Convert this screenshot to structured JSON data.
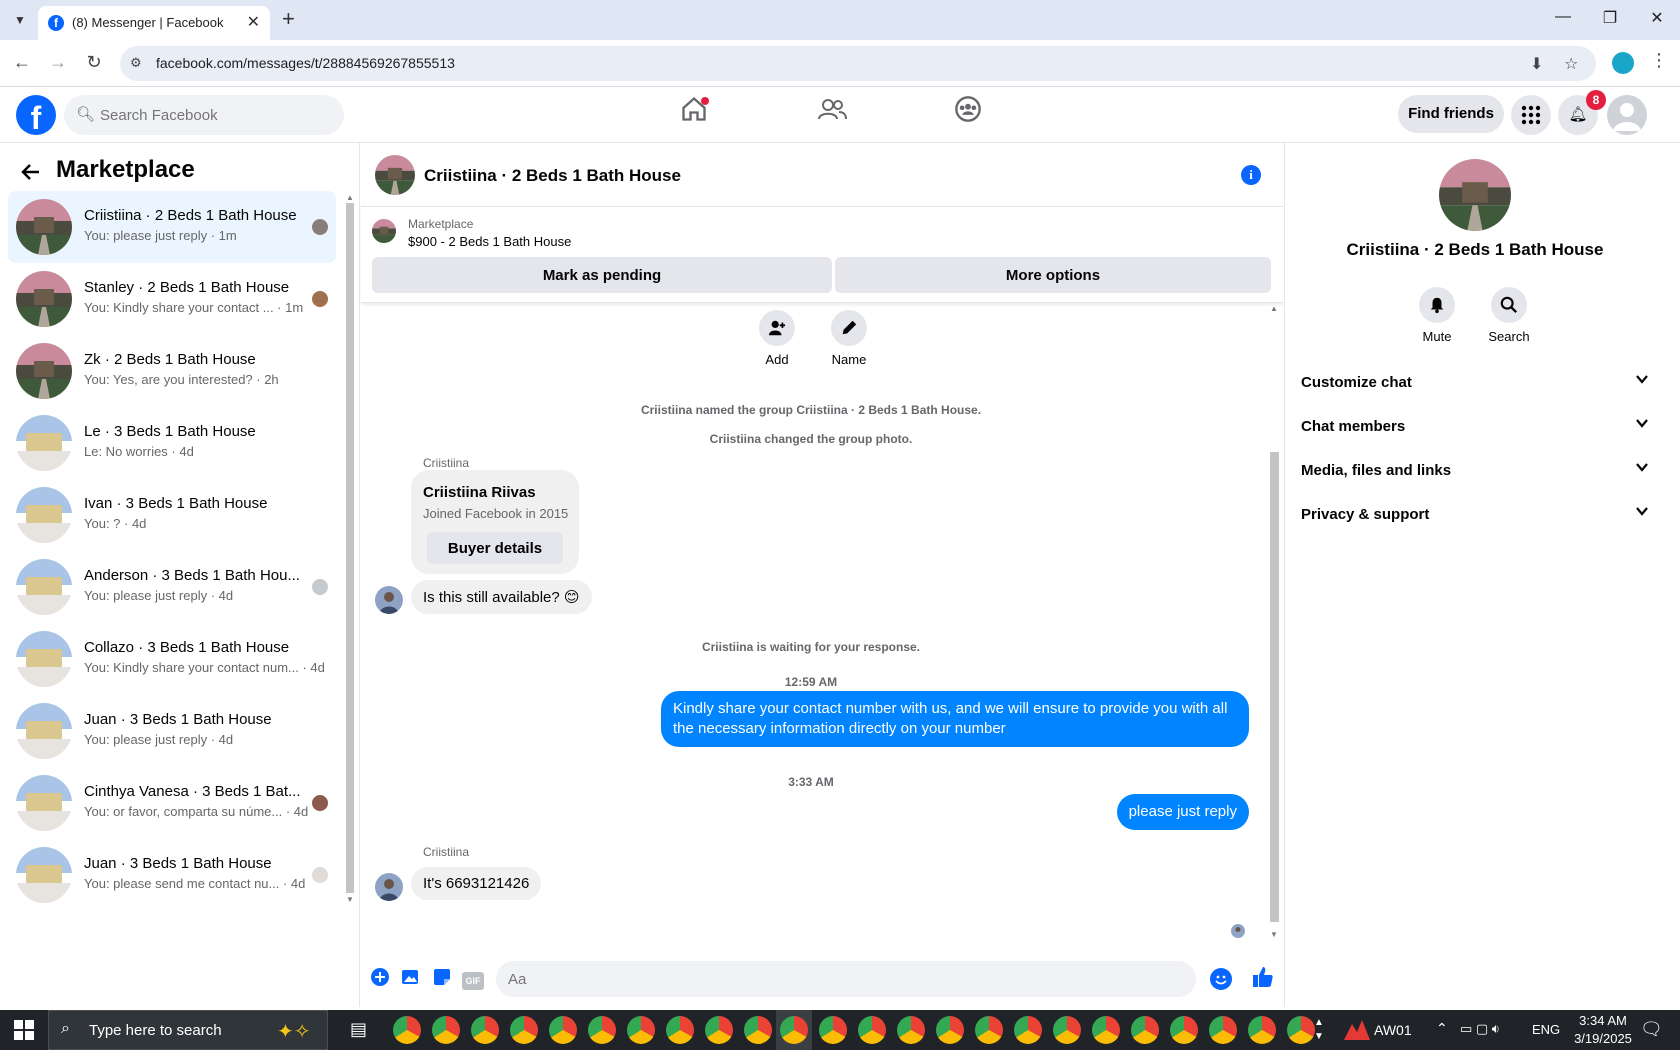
{
  "browser": {
    "tab_title": "(8) Messenger | Facebook",
    "url": "facebook.com/messages/t/28884569267855513"
  },
  "header": {
    "search_placeholder": "Search Facebook",
    "find_friends": "Find friends",
    "notification_count": "8"
  },
  "sidebar": {
    "title": "Marketplace",
    "conversations": [
      {
        "title": "Criistiina · 2 Beds 1 Bath House",
        "subtitle": "You: please just reply · 1m",
        "active": true
      },
      {
        "title": "Stanley · 2 Beds 1 Bath House",
        "subtitle": "You: Kindly share your contact ... · 1m"
      },
      {
        "title": "Zk · 2 Beds 1 Bath House",
        "subtitle": "You: Yes, are you interested? · 2h"
      },
      {
        "title": "Le · 3 Beds 1 Bath House",
        "subtitle": "Le: No worries · 4d"
      },
      {
        "title": "Ivan · 3 Beds 1 Bath House",
        "subtitle": "You: ? · 4d"
      },
      {
        "title": "Anderson · 3 Beds 1 Bath Hou...",
        "subtitle": "You: please just reply · 4d"
      },
      {
        "title": "Collazo · 3 Beds 1 Bath House",
        "subtitle": "You: Kindly share your contact num... · 4d"
      },
      {
        "title": "Juan · 3 Beds 1 Bath House",
        "subtitle": "You: please just reply · 4d"
      },
      {
        "title": "Cinthya Vanesa · 3 Beds 1 Bat...",
        "subtitle": "You: or favor, comparta su núme... · 4d"
      },
      {
        "title": "Juan · 3 Beds 1 Bath House",
        "subtitle": "You: please send me contact nu... · 4d"
      }
    ]
  },
  "chat": {
    "title": "Criistiina · 2 Beds 1 Bath House",
    "marketplace_label": "Marketplace",
    "listing": "$900 - 2 Beds 1 Bath House",
    "mark_pending": "Mark as pending",
    "more_options": "More options",
    "add_label": "Add",
    "name_label": "Name",
    "sys_named": "Criistiina named the group Criistiina · 2 Beds 1 Bath House.",
    "sys_photo": "Criistiina changed the group photo.",
    "sender": "Criistiina",
    "card_name": "Criistiina Riivas",
    "card_sub": "Joined Facebook in 2015",
    "buyer_details": "Buyer details",
    "msg_available": "Is this still available? 😊",
    "sys_waiting": "Criistiina is waiting for your response.",
    "time1": "12:59 AM",
    "msg_out_1": "Kindly share your contact number with us, and we will ensure to provide you with all the necessary information directly on your number",
    "time2": "3:33 AM",
    "msg_out_2": "please just reply",
    "msg_reply": "It's 6693121426",
    "composer_placeholder": "Aa"
  },
  "right_panel": {
    "title": "Criistiina · 2 Beds 1 Bath House",
    "mute": "Mute",
    "search": "Search",
    "sections": [
      "Customize chat",
      "Chat members",
      "Media, files and links",
      "Privacy & support"
    ]
  },
  "taskbar": {
    "search_placeholder": "Type here to search",
    "account": "AW01",
    "lang": "ENG",
    "time": "3:34 AM",
    "date": "3/19/2025"
  },
  "colors": {
    "brand": "#0866ff",
    "outgoing_bubble": "#0084ff",
    "active_conversation": "#ebf5ff"
  }
}
